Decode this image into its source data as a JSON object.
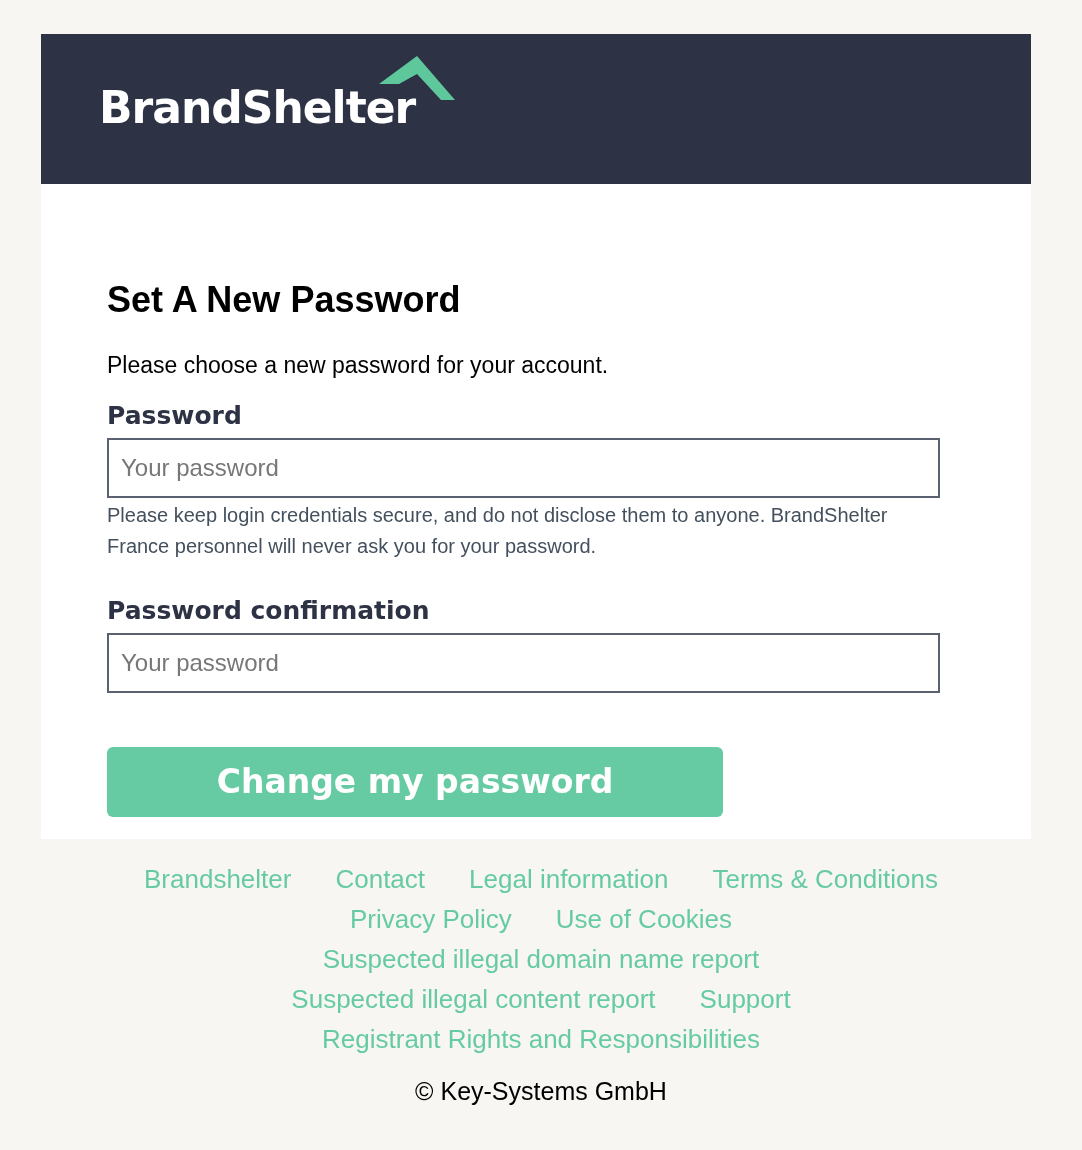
{
  "header": {
    "logo_text": "BrandShelter"
  },
  "form": {
    "title": "Set A New Password",
    "intro": "Please choose a new password for your account.",
    "fields": [
      {
        "label": "Password",
        "placeholder": "Your password",
        "hint": "Please keep login credentials secure, and do not disclose them to anyone. BrandShelter France personnel will never ask you for your password."
      },
      {
        "label": "Password confirmation",
        "placeholder": "Your password"
      }
    ],
    "submit": "Change my password"
  },
  "footer": {
    "link_rows": [
      [
        "Brandshelter",
        "Contact",
        "Legal information",
        "Terms & Conditions"
      ],
      [
        "Privacy Policy",
        "Use of Cookies"
      ],
      [
        "Suspected illegal domain name report"
      ],
      [
        "Suspected illegal content report",
        "Support"
      ],
      [
        "Registrant Rights and Responsibilities"
      ]
    ],
    "copyright": "© Key-Systems GmbH"
  }
}
